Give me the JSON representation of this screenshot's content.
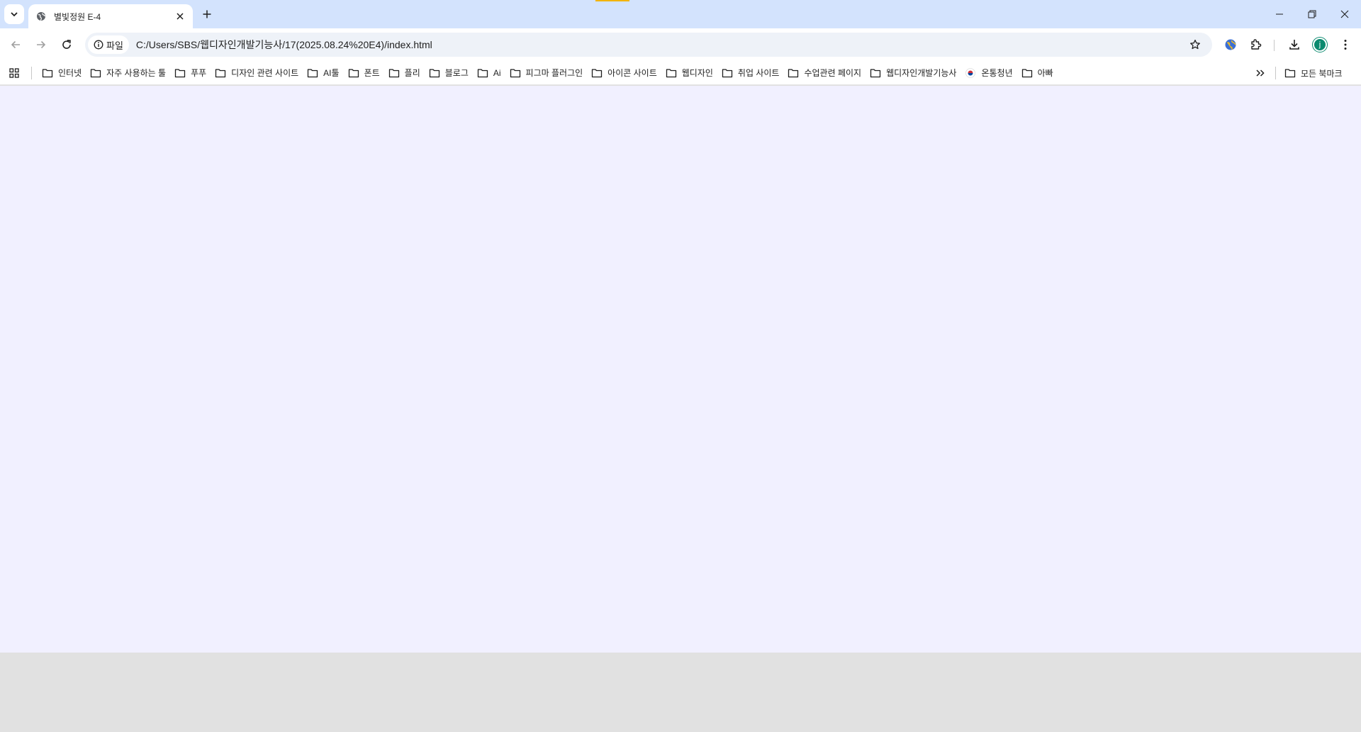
{
  "browser": {
    "tab": {
      "title": "별빛정원 E-4"
    },
    "omnibox": {
      "site_label": "파일",
      "url": "C:/Users/SBS/웹디자인개발기능사/17(2025.08.24%20E4)/index.html"
    },
    "profile_initial": "j",
    "profile_color": "#0b8a6f"
  },
  "bookmarks": {
    "items": [
      {
        "label": "인터넷",
        "icon": "folder-icon"
      },
      {
        "label": "자주 사용하는 툴",
        "icon": "folder-icon"
      },
      {
        "label": "푸푸",
        "icon": "folder-icon"
      },
      {
        "label": "디자인 관련 사이트",
        "icon": "folder-icon"
      },
      {
        "label": "AI툴",
        "icon": "folder-icon"
      },
      {
        "label": "폰트",
        "icon": "folder-icon"
      },
      {
        "label": "플리",
        "icon": "folder-icon"
      },
      {
        "label": "블로그",
        "icon": "folder-icon"
      },
      {
        "label": "Ai",
        "icon": "folder-icon"
      },
      {
        "label": "피그마 플러그인",
        "icon": "folder-icon"
      },
      {
        "label": "아이콘 사이트",
        "icon": "folder-icon"
      },
      {
        "label": "웹디자인",
        "icon": "folder-icon"
      },
      {
        "label": "취업 사이트",
        "icon": "folder-icon"
      },
      {
        "label": "수업관련 페이지",
        "icon": "folder-icon"
      },
      {
        "label": "웹디자인개발기능사",
        "icon": "folder-icon"
      },
      {
        "label": "온통청년",
        "icon": "korea-flag-icon"
      },
      {
        "label": "아빠",
        "icon": "folder-icon"
      }
    ],
    "all_bookmarks_label": "모든 북마크"
  },
  "colors": {
    "tabstrip": "#d3e3fd",
    "page_background": "#f1f0ff",
    "below_page": "#e1e1e1"
  }
}
